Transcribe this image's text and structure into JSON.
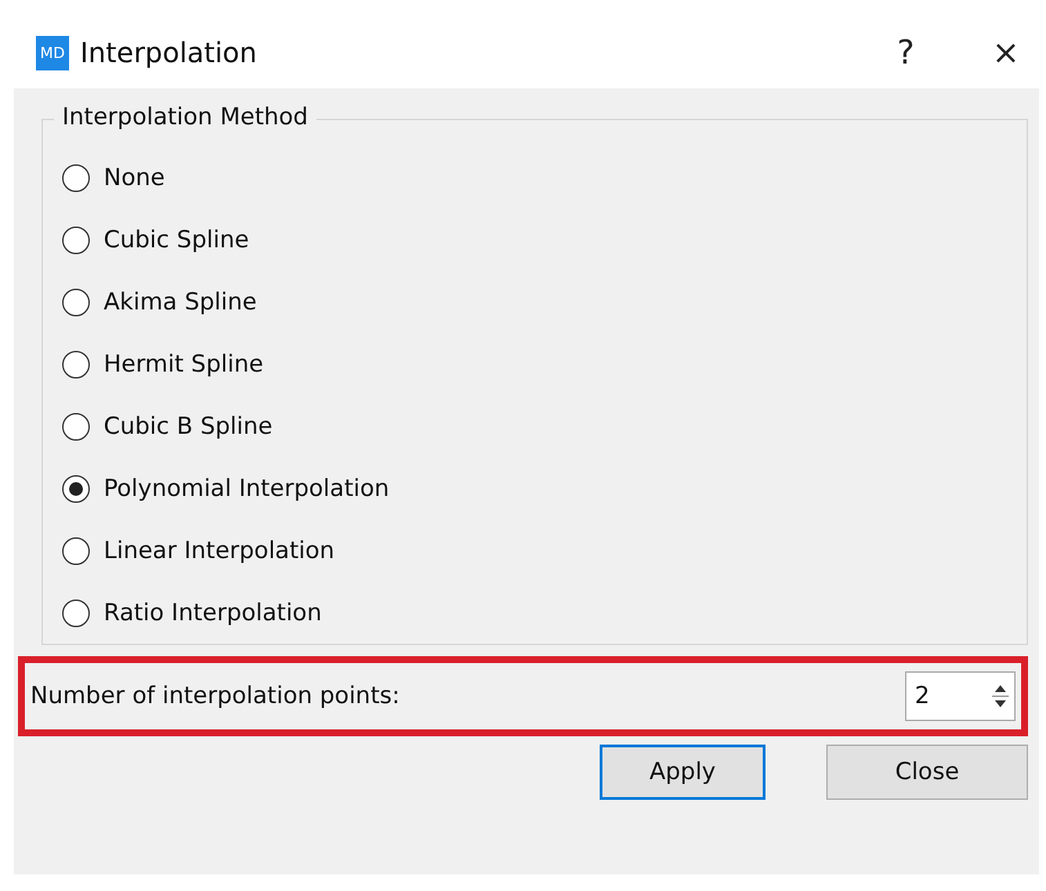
{
  "window": {
    "logo": "MD",
    "title": "Interpolation",
    "help": "?",
    "close": "×"
  },
  "group": {
    "title": "Interpolation Method",
    "options": [
      {
        "label": "None",
        "selected": false
      },
      {
        "label": "Cubic Spline",
        "selected": false
      },
      {
        "label": "Akima Spline",
        "selected": false
      },
      {
        "label": "Hermit Spline",
        "selected": false
      },
      {
        "label": "Cubic B Spline",
        "selected": false
      },
      {
        "label": "Polynomial Interpolation",
        "selected": true
      },
      {
        "label": "Linear Interpolation",
        "selected": false
      },
      {
        "label": "Ratio Interpolation",
        "selected": false
      }
    ]
  },
  "points": {
    "label": "Number of interpolation points:",
    "value": "2",
    "highlighted": true
  },
  "buttons": [
    {
      "label": "Apply",
      "default": true
    },
    {
      "label": "Close",
      "default": false
    }
  ]
}
